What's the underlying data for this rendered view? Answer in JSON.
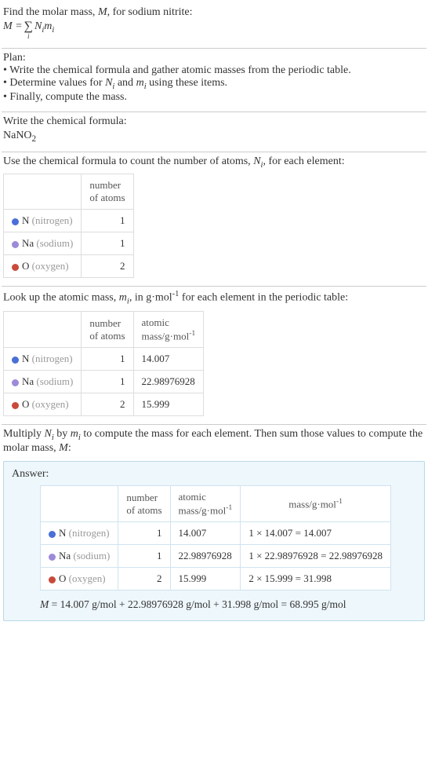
{
  "intro": {
    "line1_pre": "Find the molar mass, ",
    "line1_M": "M",
    "line1_post": ", for sodium nitrite:",
    "eq_lhs": "M = ",
    "eq_sum_idx": "i",
    "eq_term_N": "N",
    "eq_term_i1": "i",
    "eq_term_m": "m",
    "eq_term_i2": "i"
  },
  "plan": {
    "heading": "Plan:",
    "b1_pre": "• Write the chemical formula and gather atomic masses from the periodic table.",
    "b2_pre": "• Determine values for ",
    "b2_N": "N",
    "b2_i1": "i",
    "b2_mid": " and ",
    "b2_m": "m",
    "b2_i2": "i",
    "b2_post": " using these items.",
    "b3": "• Finally, compute the mass."
  },
  "formula_sec": {
    "heading": "Write the chemical formula:",
    "chem_pre": "NaNO",
    "chem_sub": "2"
  },
  "count_sec": {
    "text_pre": "Use the chemical formula to count the number of atoms, ",
    "text_N": "N",
    "text_i": "i",
    "text_post": ", for each element:",
    "col_atoms_l1": "number",
    "col_atoms_l2": "of atoms",
    "rows": [
      {
        "sym": "N",
        "name": "(nitrogen)",
        "atoms": "1"
      },
      {
        "sym": "Na",
        "name": "(sodium)",
        "atoms": "1"
      },
      {
        "sym": "O",
        "name": "(oxygen)",
        "atoms": "2"
      }
    ]
  },
  "mass_sec": {
    "text_pre": "Look up the atomic mass, ",
    "text_m": "m",
    "text_i": "i",
    "text_mid": ", in g·mol",
    "text_exp": "-1",
    "text_post": " for each element in the periodic table:",
    "col_atoms_l1": "number",
    "col_atoms_l2": "of atoms",
    "col_mass_l1": "atomic",
    "col_mass_l2a": "mass/g·mol",
    "col_mass_exp": "-1",
    "rows": [
      {
        "sym": "N",
        "name": "(nitrogen)",
        "atoms": "1",
        "mass": "14.007"
      },
      {
        "sym": "Na",
        "name": "(sodium)",
        "atoms": "1",
        "mass": "22.98976928"
      },
      {
        "sym": "O",
        "name": "(oxygen)",
        "atoms": "2",
        "mass": "15.999"
      }
    ]
  },
  "mult_sec": {
    "t1": "Multiply ",
    "N": "N",
    "i1": "i",
    "t2": " by ",
    "m": "m",
    "i2": "i",
    "t3": " to compute the mass for each element. Then sum those values to compute the molar mass, ",
    "M": "M",
    "t4": ":"
  },
  "answer": {
    "label": "Answer:",
    "col_atoms_l1": "number",
    "col_atoms_l2": "of atoms",
    "col_amass_l1": "atomic",
    "col_amass_l2a": "mass/g·mol",
    "col_amass_exp": "-1",
    "col_mass_l1a": "mass/g·mol",
    "col_mass_exp": "-1",
    "rows": [
      {
        "sym": "N",
        "name": "(nitrogen)",
        "atoms": "1",
        "amass": "14.007",
        "calc": "1 × 14.007 = 14.007"
      },
      {
        "sym": "Na",
        "name": "(sodium)",
        "atoms": "1",
        "amass": "22.98976928",
        "calc": "1 × 22.98976928 = 22.98976928"
      },
      {
        "sym": "O",
        "name": "(oxygen)",
        "atoms": "2",
        "amass": "15.999",
        "calc": "2 × 15.999 = 31.998"
      }
    ],
    "eq_M": "M",
    "eq_rest": " = 14.007 g/mol + 22.98976928 g/mol + 31.998 g/mol = 68.995 g/mol"
  },
  "chart_data": {
    "type": "table",
    "title": "Molar mass of sodium nitrite (NaNO2)",
    "columns": [
      "element",
      "number_of_atoms",
      "atomic_mass_g_per_mol",
      "mass_g_per_mol"
    ],
    "rows": [
      {
        "element": "N (nitrogen)",
        "number_of_atoms": 1,
        "atomic_mass_g_per_mol": 14.007,
        "mass_g_per_mol": 14.007
      },
      {
        "element": "Na (sodium)",
        "number_of_atoms": 1,
        "atomic_mass_g_per_mol": 22.98976928,
        "mass_g_per_mol": 22.98976928
      },
      {
        "element": "O (oxygen)",
        "number_of_atoms": 2,
        "atomic_mass_g_per_mol": 15.999,
        "mass_g_per_mol": 31.998
      }
    ],
    "molar_mass_g_per_mol": 68.995
  }
}
